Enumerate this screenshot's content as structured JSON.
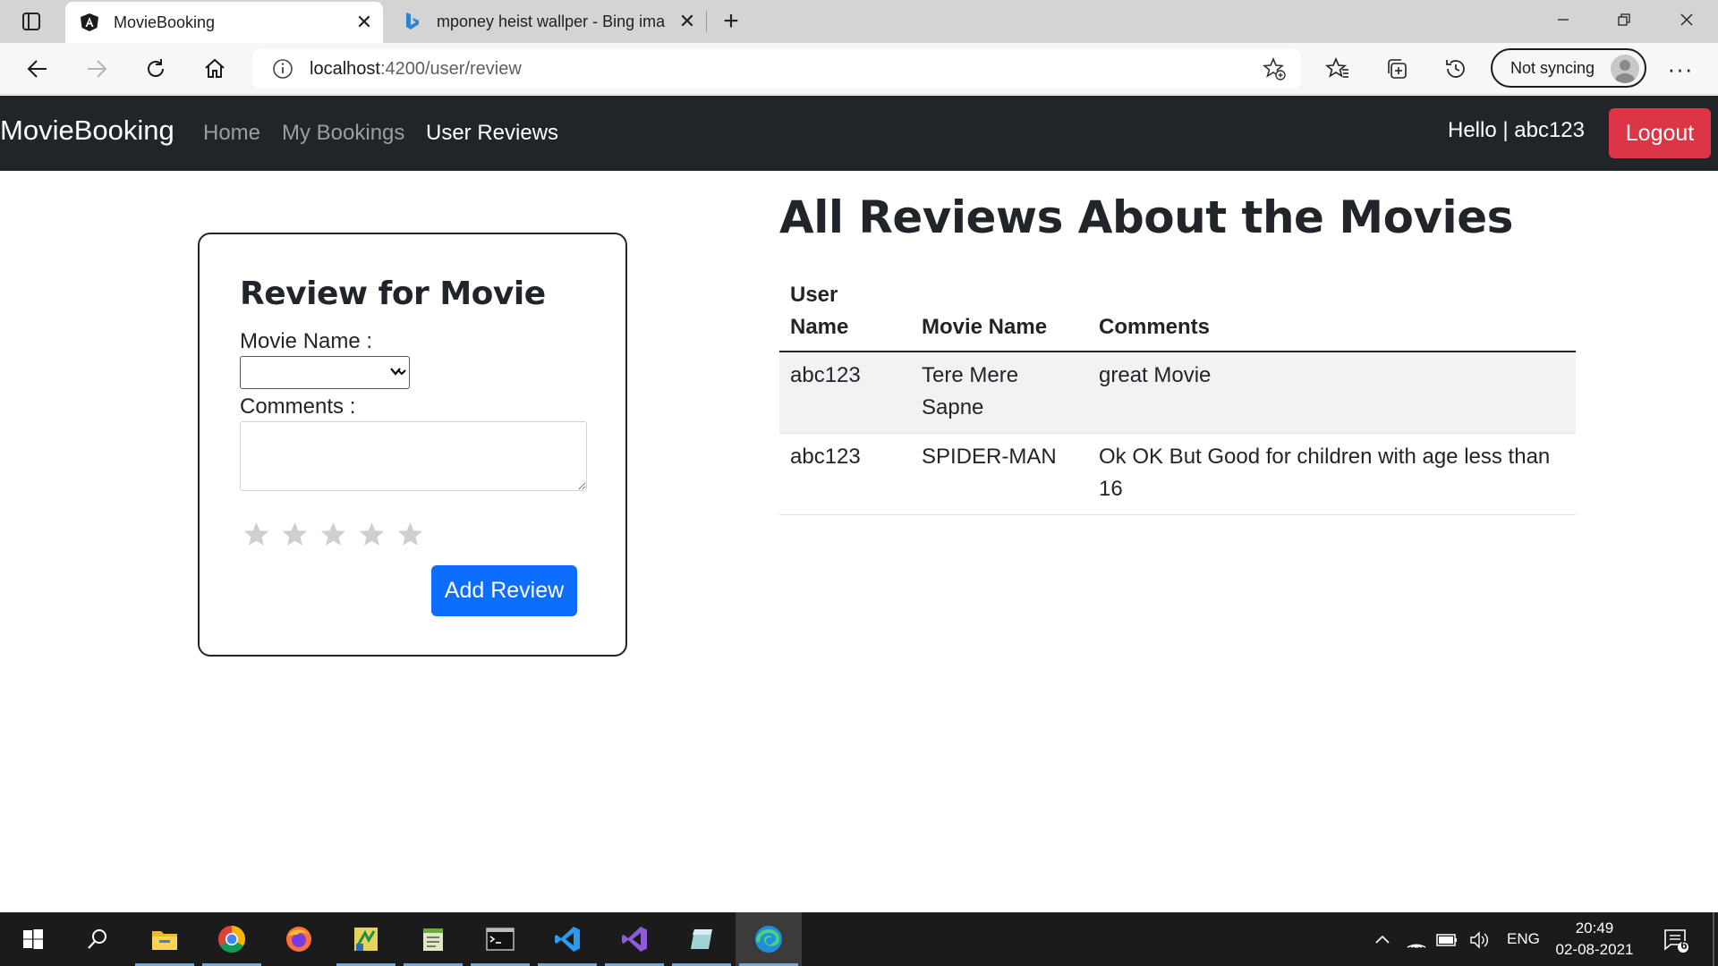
{
  "browser": {
    "tabs": [
      {
        "title": "MovieBooking",
        "icon": "angular-icon",
        "active": true
      },
      {
        "title": "mponey heist wallper - Bing ima",
        "icon": "bing-icon",
        "active": false
      }
    ],
    "url_host": "localhost",
    "url_path": ":4200/user/review",
    "sync_label": "Not syncing"
  },
  "navbar": {
    "brand": "MovieBooking",
    "links": [
      {
        "label": "Home",
        "active": false
      },
      {
        "label": "My Bookings",
        "active": false
      },
      {
        "label": "User Reviews",
        "active": true
      }
    ],
    "greeting": "Hello | abc123",
    "logout_label": "Logout",
    "logout_color": "#dc3545"
  },
  "review_form": {
    "title": "Review for Movie",
    "movie_label": "Movie Name :",
    "movie_value": "",
    "comments_label": "Comments :",
    "comments_value": "",
    "rating": 0,
    "max_rating": 5,
    "submit_label": "Add Review",
    "submit_color": "#0d6efd"
  },
  "reviews": {
    "title": "All Reviews About the Movies",
    "headers": [
      "User Name",
      "Movie Name",
      "Comments"
    ],
    "rows": [
      {
        "user": "abc123",
        "movie": "Tere Mere Sapne",
        "comment": "great Movie"
      },
      {
        "user": "abc123",
        "movie": "SPIDER-MAN",
        "comment": "Ok OK But Good for children with age less than 16"
      }
    ]
  },
  "taskbar": {
    "apps": [
      "file-explorer-icon",
      "chrome-icon",
      "firefox-icon",
      "app-icon",
      "notepad-icon",
      "terminal-icon",
      "vscode-icon",
      "visual-studio-icon",
      "app-icon",
      "edge-icon"
    ],
    "language": "ENG",
    "time": "20:49",
    "date": "02-08-2021",
    "notification_count": "6"
  }
}
